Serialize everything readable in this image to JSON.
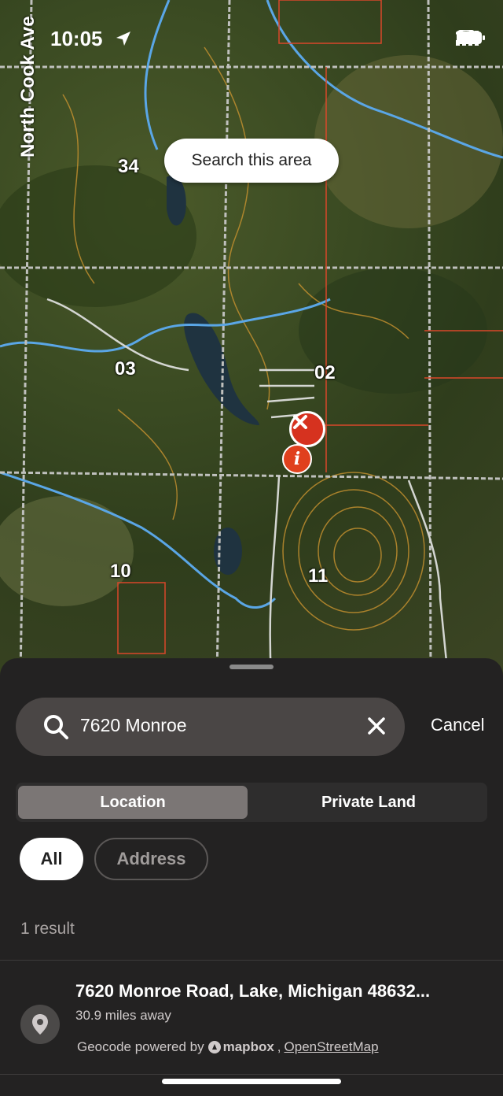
{
  "status_bar": {
    "time": "10:05"
  },
  "map": {
    "road_label": "North Cook Ave",
    "search_area_button": "Search this area",
    "sections": [
      "34",
      "03",
      "02",
      "10",
      "11"
    ],
    "info_marker": "i"
  },
  "sheet": {
    "search": {
      "value": "7620 Monroe",
      "cancel_label": "Cancel"
    },
    "segments": {
      "active": "Location",
      "inactive": "Private Land"
    },
    "chips": {
      "all": "All",
      "address": "Address"
    },
    "result_count": "1 result",
    "results": [
      {
        "title": "7620 Monroe Road, Lake, Michigan 48632...",
        "distance": "30.9 miles away"
      }
    ],
    "attribution": {
      "prefix": "Geocode powered by",
      "mapbox": "mapbox",
      "sep": ",",
      "osm": "OpenStreetMap"
    }
  },
  "colors": {
    "pin_red": "#d6321f",
    "sheet_bg": "#232222",
    "segment_active": "#7b7675"
  }
}
